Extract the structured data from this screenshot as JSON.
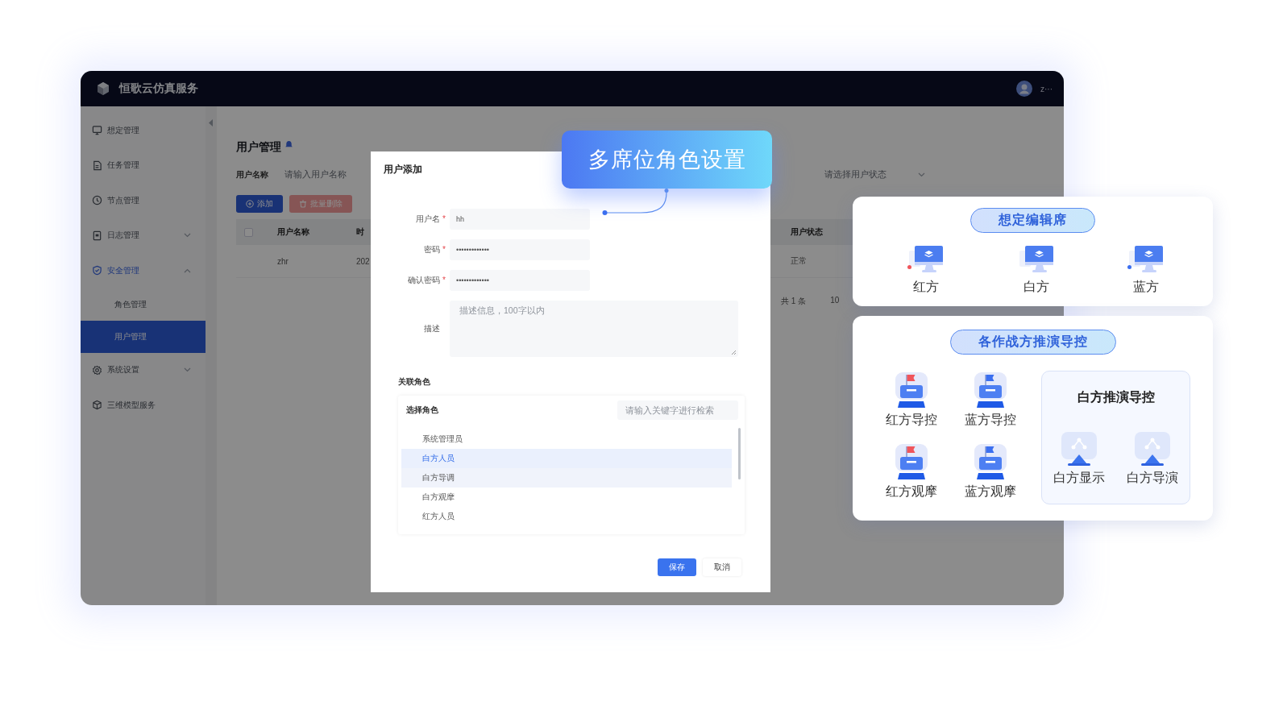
{
  "app": {
    "title": "恒歌云仿真服务",
    "user": "z···",
    "sidebar": {
      "items": [
        {
          "label": "想定管理",
          "selected": false
        },
        {
          "label": "任务管理",
          "selected": false
        },
        {
          "label": "节点管理",
          "selected": false
        },
        {
          "label": "日志管理",
          "selected": false,
          "expanded": false
        },
        {
          "label": "安全管理",
          "selected": true,
          "expanded": true,
          "children": [
            {
              "label": "角色管理",
              "selected": false
            },
            {
              "label": "用户管理",
              "selected": true
            }
          ]
        },
        {
          "label": "系统设置",
          "selected": false,
          "expanded": false
        },
        {
          "label": "三维模型服务",
          "selected": false
        }
      ]
    },
    "page": {
      "title": "用户管理",
      "filters": [
        {
          "label": "用户名称",
          "placeholder": "请输入用户名称"
        },
        {
          "placeholder": "请选择用户状态"
        }
      ],
      "buttons": [
        {
          "label": "添加",
          "kind": "primary"
        },
        {
          "label": "批量删除",
          "kind": "danger"
        }
      ],
      "table": {
        "checked": false,
        "columns": [
          "用户名称",
          "时",
          "用户状态"
        ],
        "rows": [
          [
            "zhr",
            "202",
            "正常"
          ]
        ]
      },
      "pagination": {
        "total": "共 1 条",
        "page_size": "10"
      }
    }
  },
  "dialog": {
    "title": "用户添加",
    "fields": [
      {
        "kind": "text",
        "label": "用户名",
        "required_mark": "*",
        "value": "hh"
      },
      {
        "kind": "text",
        "label": "密码",
        "required_mark": "*",
        "value": "•••••••••••••"
      },
      {
        "kind": "text",
        "label": "确认密码",
        "required_mark": "*",
        "value": "•••••••••••••"
      },
      {
        "kind": "textarea",
        "label": "描述",
        "placeholder": "描述信息，100字以内"
      }
    ],
    "roles": {
      "title": "关联角色",
      "header": "选择角色",
      "search_placeholder": "请输入关键字进行检索",
      "items": [
        {
          "label": "系统管理员",
          "selected": false,
          "hovered": false
        },
        {
          "label": "白方人员",
          "selected": true,
          "hovered": false
        },
        {
          "label": "白方导调",
          "selected": false,
          "hovered": true
        },
        {
          "label": "白方观摩",
          "selected": false,
          "hovered": false
        },
        {
          "label": "红方人员",
          "selected": false,
          "hovered": false
        }
      ]
    },
    "buttons": [
      {
        "label": "保存",
        "kind": "primary"
      },
      {
        "label": "取消",
        "kind": "default"
      }
    ]
  },
  "callout": {
    "text": "多席位角色设置"
  },
  "seat_panels": [
    {
      "title": "想定编辑席",
      "items": [
        {
          "kind": "monitor",
          "label": "红方",
          "color": "#f0555b"
        },
        {
          "kind": "monitor",
          "label": "白方"
        },
        {
          "kind": "monitor",
          "label": "蓝方",
          "color": "#3b6ff0"
        }
      ]
    },
    {
      "title": "各作战方推演导控",
      "items": [
        {
          "kind": "console",
          "label": "红方导控",
          "color": "#f0555b"
        },
        {
          "kind": "console",
          "label": "蓝方导控",
          "color": "#3b6ff0"
        },
        {
          "kind": "console",
          "label": "红方观摩",
          "color": "#f0555b"
        },
        {
          "kind": "console",
          "label": "蓝方观摩",
          "color": "#3b6ff0"
        }
      ],
      "group": {
        "title": "白方推演导控",
        "items": [
          {
            "kind": "display",
            "label": "白方显示"
          },
          {
            "kind": "display",
            "label": "白方导演"
          }
        ]
      }
    }
  ]
}
